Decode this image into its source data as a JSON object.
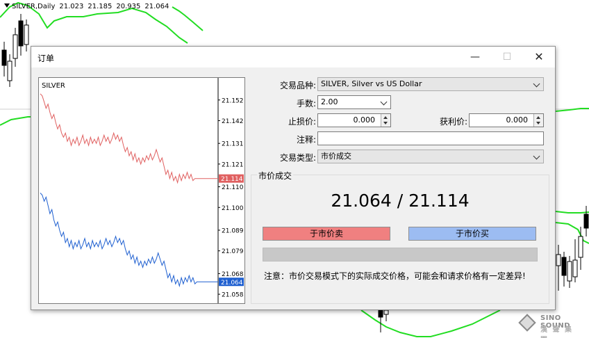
{
  "background_chart": {
    "symbol_label": "SILVER,Daily",
    "open": "21.023",
    "high": "21.185",
    "low": "20.935",
    "close": "21.064",
    "band_color": "#22dd22"
  },
  "watermark": {
    "line1": "SINO SOUND",
    "line2": "漢 聲 集 團"
  },
  "dialog": {
    "title": "订单",
    "controls": {
      "minimize": "—",
      "maximize": "☐",
      "close": "✕"
    }
  },
  "chart_data": {
    "type": "line",
    "title": "SILVER",
    "y_ticks": [
      "21.152",
      "21.142",
      "21.131",
      "21.121",
      "21.110",
      "21.100",
      "21.089",
      "21.079",
      "21.068",
      "21.058"
    ],
    "ylim": [
      21.055,
      21.16
    ],
    "current_ask": {
      "label": "21.114",
      "value": 21.114,
      "color": "#e06060"
    },
    "current_bid": {
      "label": "21.064",
      "value": 21.064,
      "color": "#1e5fd0"
    },
    "series": [
      {
        "color": "#e06060",
        "values": [
          21.155,
          21.154,
          21.151,
          21.148,
          21.15,
          21.146,
          21.143,
          21.145,
          21.141,
          21.138,
          21.14,
          21.136,
          21.134,
          21.136,
          21.132,
          21.134,
          21.13,
          21.133,
          21.131,
          21.134,
          21.13,
          21.132,
          21.135,
          21.131,
          21.133,
          21.13,
          21.134,
          21.131,
          21.133,
          21.131,
          21.134,
          21.13,
          21.132,
          21.135,
          21.132,
          21.134,
          21.131,
          21.133,
          21.136,
          21.133,
          21.135,
          21.132,
          21.134,
          21.13,
          21.127,
          21.129,
          21.125,
          21.127,
          21.123,
          21.126,
          21.122,
          21.124,
          21.121,
          21.124,
          21.122,
          21.125,
          21.123,
          21.126,
          21.123,
          21.125,
          21.128,
          21.125,
          21.122,
          21.124,
          21.12,
          21.116,
          21.118,
          21.114,
          21.117,
          21.113,
          21.115,
          21.112,
          21.116,
          21.113,
          21.116,
          21.114,
          21.117,
          21.114,
          21.116,
          21.113,
          21.114,
          21.114,
          21.114,
          21.114,
          21.114,
          21.114,
          21.114,
          21.114,
          21.114,
          21.114,
          21.114,
          21.114,
          21.114
        ]
      },
      {
        "color": "#1e5fd0",
        "values": [
          21.107,
          21.106,
          21.103,
          21.105,
          21.101,
          21.097,
          21.099,
          21.094,
          21.091,
          21.093,
          21.089,
          21.086,
          21.088,
          21.083,
          21.085,
          21.081,
          21.084,
          21.08,
          21.083,
          21.081,
          21.084,
          21.08,
          21.082,
          21.085,
          21.081,
          21.083,
          21.08,
          21.084,
          21.081,
          21.083,
          21.081,
          21.084,
          21.08,
          21.082,
          21.085,
          21.082,
          21.084,
          21.081,
          21.083,
          21.086,
          21.083,
          21.085,
          21.082,
          21.084,
          21.08,
          21.077,
          21.079,
          21.075,
          21.077,
          21.073,
          21.076,
          21.072,
          21.074,
          21.071,
          21.074,
          21.072,
          21.075,
          21.073,
          21.076,
          21.073,
          21.075,
          21.078,
          21.075,
          21.072,
          21.074,
          21.07,
          21.066,
          21.068,
          21.064,
          21.067,
          21.063,
          21.065,
          21.062,
          21.066,
          21.063,
          21.066,
          21.064,
          21.067,
          21.064,
          21.066,
          21.063,
          21.064,
          21.064,
          21.064,
          21.064,
          21.064,
          21.064,
          21.064,
          21.064,
          21.064,
          21.064,
          21.064,
          21.064
        ]
      }
    ]
  },
  "form": {
    "symbol_label": "交易品种:",
    "symbol_value": "SILVER, Silver vs US Dollar",
    "volume_label": "手数:",
    "volume_value": "2.00",
    "sl_label": "止损价:",
    "sl_value": "0.000",
    "tp_label": "获利价:",
    "tp_value": "0.000",
    "comment_label": "注释:",
    "comment_value": "",
    "type_label": "交易类型:",
    "type_value": "市价成交"
  },
  "market": {
    "group_title": "市价成交",
    "price_text": "21.064 / 21.114",
    "sell_label": "于市价卖",
    "buy_label": "于市价买",
    "sell_color": "#f08080",
    "buy_color": "#9cbcf2",
    "note": "注意：市价交易模式下的实际成交价格，可能会和请求价格有一定差异!"
  }
}
